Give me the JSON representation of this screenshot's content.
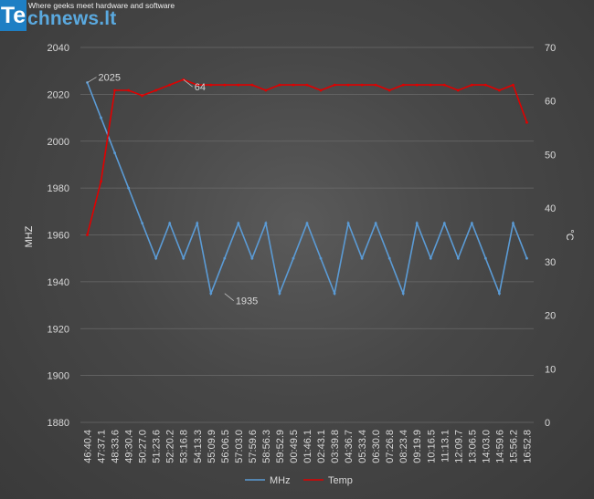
{
  "logo": {
    "letter": "Te",
    "rest": "chnews.lt",
    "tagline": "Where geeks meet hardware and software"
  },
  "chart_data": {
    "type": "line",
    "title": "",
    "xlabel": "",
    "ylabel": "MHZ",
    "y2label": "°C",
    "ylim": [
      1880,
      2040
    ],
    "y_ticks": [
      1880,
      1900,
      1920,
      1940,
      1960,
      1980,
      2000,
      2020,
      2040
    ],
    "y2lim": [
      0,
      70
    ],
    "y2_ticks": [
      0,
      10,
      20,
      30,
      40,
      50,
      60,
      70
    ],
    "grid": true,
    "legend_position": "bottom",
    "categories": [
      "46:40.4",
      "47:37.1",
      "48:33.6",
      "49:30.4",
      "50:27.0",
      "51:23.6",
      "52:20.2",
      "53:16.8",
      "54:13.3",
      "55:09.9",
      "56:06.5",
      "57:03.0",
      "57:59.6",
      "58:56.3",
      "59:52.9",
      "00:49.5",
      "01:46.1",
      "02:43.1",
      "03:39.8",
      "04:36.7",
      "05:33.4",
      "06:30.0",
      "07:26.8",
      "08:23.4",
      "09:19.9",
      "10:16.5",
      "11:13.1",
      "12:09.7",
      "13:06.5",
      "14:03.0",
      "14:59.6",
      "15:56.2",
      "16:52.8"
    ],
    "series": [
      {
        "name": "MHz",
        "color": "#5b9bd5",
        "axis": "left",
        "values": [
          2025,
          2010,
          1995,
          1980,
          1965,
          1950,
          1965,
          1950,
          1965,
          1935,
          1950,
          1965,
          1950,
          1965,
          1935,
          1950,
          1965,
          1950,
          1935,
          1965,
          1950,
          1965,
          1950,
          1935,
          1965,
          1950,
          1965,
          1950,
          1965,
          1950,
          1935,
          1965,
          1950
        ]
      },
      {
        "name": "Temp",
        "color": "#e00000",
        "axis": "right",
        "values": [
          35,
          45,
          62,
          62,
          61,
          62,
          63,
          64,
          63,
          63,
          63,
          63,
          63,
          62,
          63,
          63,
          63,
          62,
          63,
          63,
          63,
          63,
          62,
          63,
          63,
          63,
          63,
          62,
          63,
          63,
          62,
          63,
          56
        ]
      }
    ],
    "annotations": [
      {
        "text": "2025",
        "series": "MHz",
        "category": "46:40.4",
        "value": 2025
      },
      {
        "text": "64",
        "series": "Temp",
        "category": "53:16.8",
        "value": 64
      },
      {
        "text": "1935",
        "series": "MHz",
        "category": "56:06.5",
        "value": 1935
      }
    ]
  }
}
